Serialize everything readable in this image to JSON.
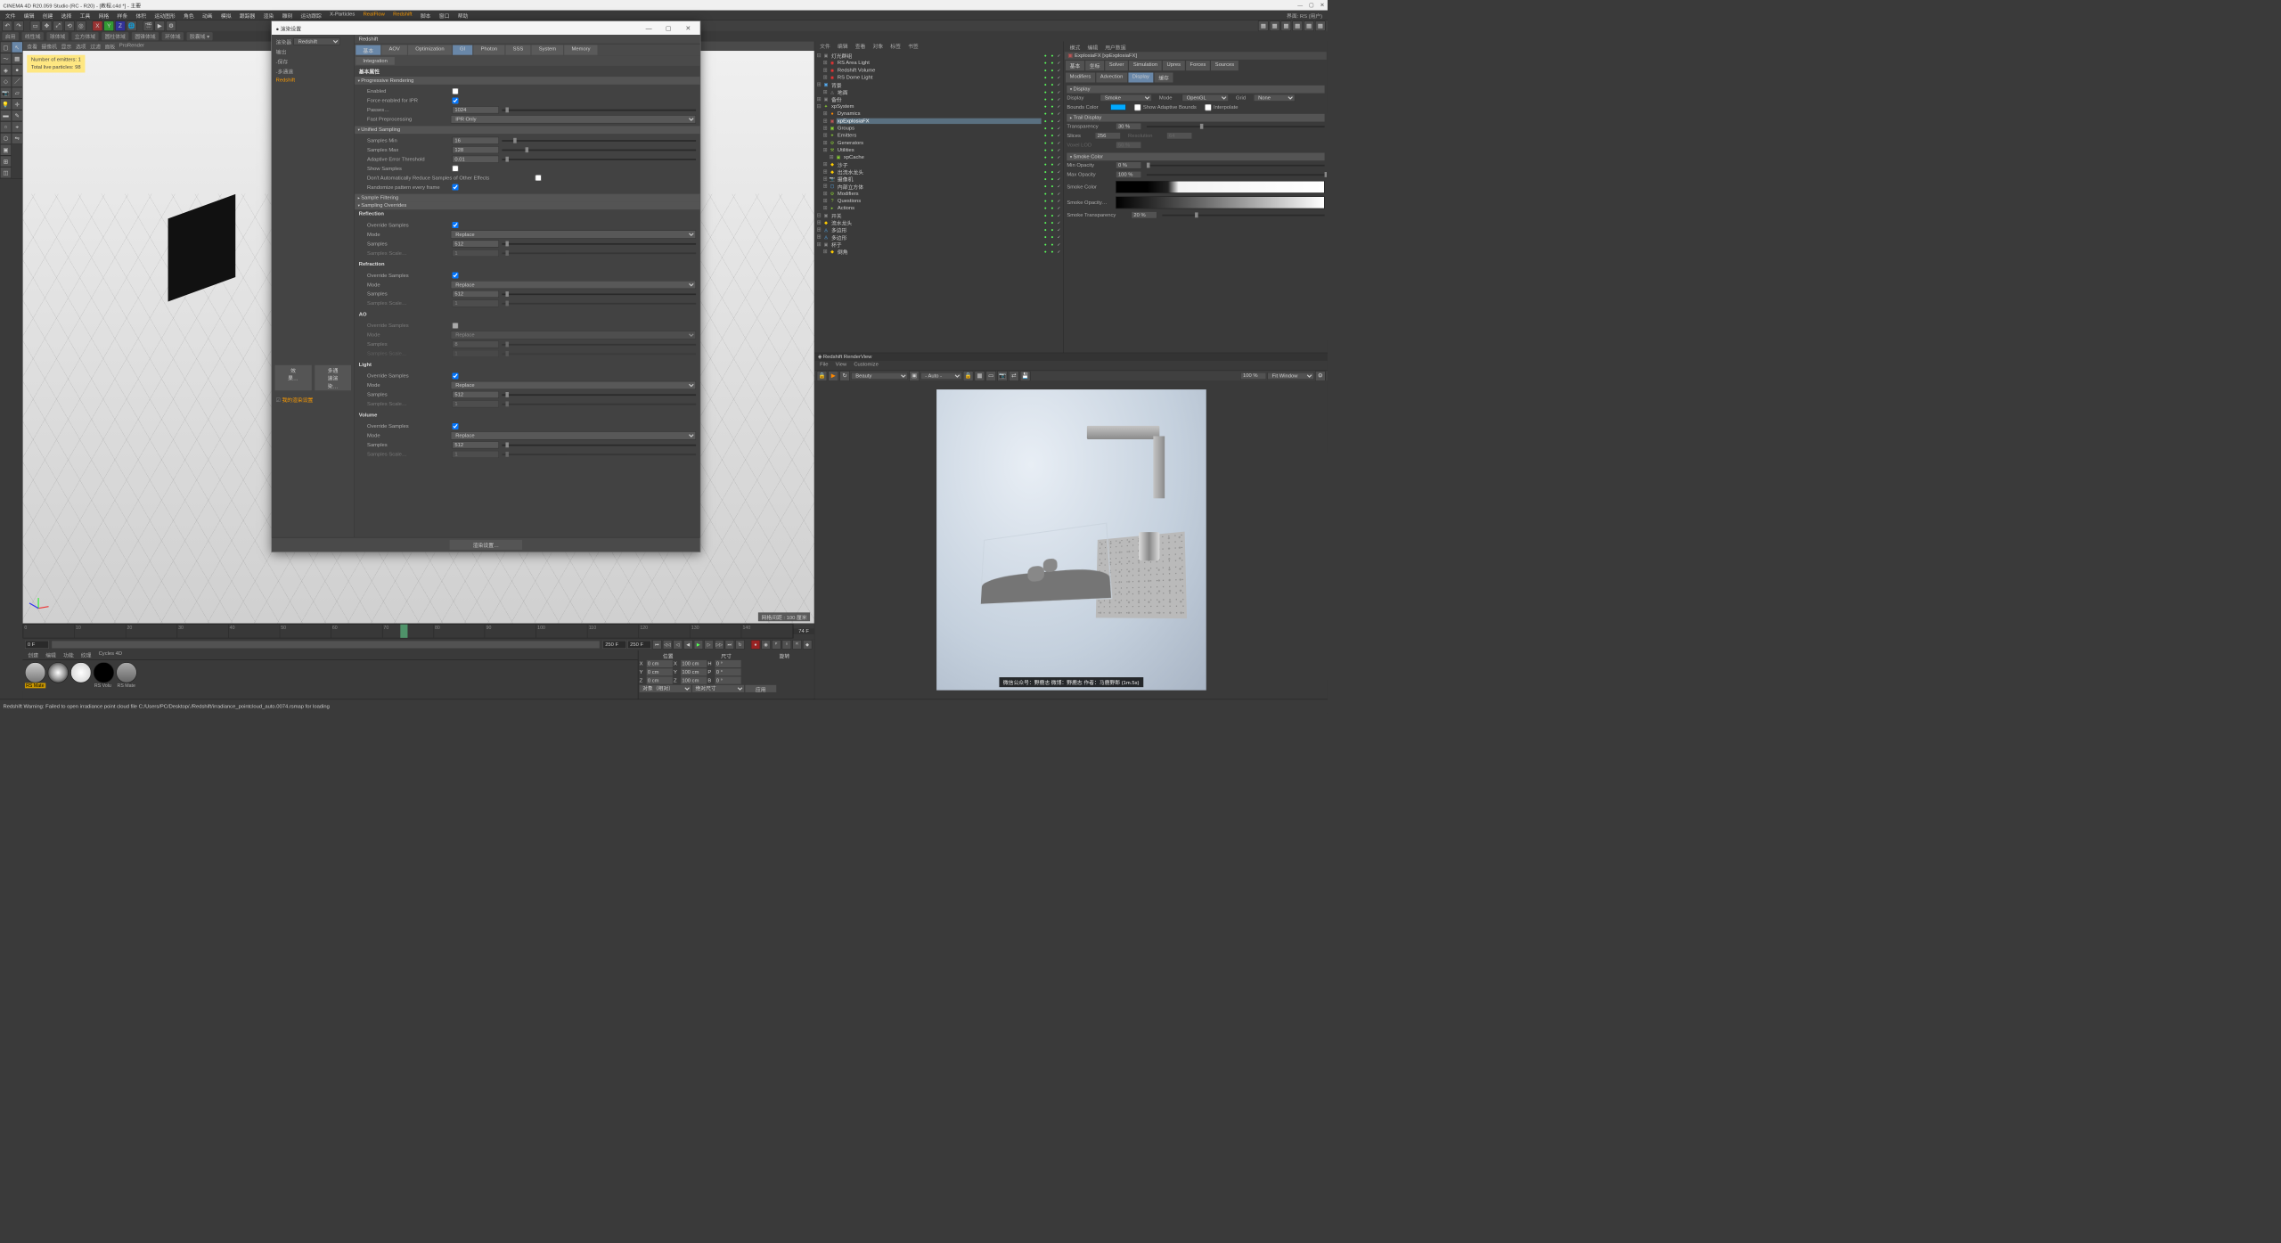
{
  "window": {
    "title": "CINEMA 4D R20.059 Studio (RC - R20) - [教程.c4d *] - 主要",
    "topright": "界面:  RS (用户)"
  },
  "menubar": [
    "文件",
    "编辑",
    "创建",
    "选择",
    "工具",
    "网格",
    "样条",
    "体积",
    "运动图形",
    "角色",
    "动画",
    "模拟",
    "跟踪器",
    "渲染",
    "雕刻",
    "运动跟踪",
    "X-Particles",
    "RealFlow",
    "Redshift",
    "脚本",
    "窗口",
    "帮助"
  ],
  "mode_tabs": [
    "启用",
    "线性域",
    "球体域",
    "立方体域",
    "圆柱体域",
    "圆锥体域",
    "环体域",
    "胶囊域 ▾"
  ],
  "view_menu": [
    "查看",
    "摄像机",
    "显示",
    "选项",
    "过滤",
    "面板",
    "ProRender"
  ],
  "hud": {
    "l1": "Number of emitters: 1",
    "l2": "Total live particles: 98"
  },
  "grid_info": "网格间距 : 100 厘米",
  "render_dialog": {
    "title": "渲染设置",
    "renderer_label": "渲染器",
    "renderer": "Redshift",
    "sidebar": [
      "输出",
      "-保存",
      "-多通道",
      "Redshift"
    ],
    "sidebar_footer": [
      "效果…",
      "多通道渲染…",
      "我的渲染设置"
    ],
    "footer_btn": "渲染设置…",
    "main_header": "Redshift",
    "tabs": [
      "基本",
      "AOV",
      "Optimization",
      "GI",
      "Photon",
      "SSS",
      "System",
      "Memory"
    ],
    "integration_tab": "Integration",
    "section_title": "基本属性",
    "groups": {
      "progressive": {
        "title": "Progressive Rendering",
        "enabled": "Enabled",
        "force_ipr": "Force enabled for IPR",
        "passes": "Passes…",
        "passes_val": "1024",
        "fastpre": "Fast Preprocessing",
        "fastpre_val": "IPR Only"
      },
      "unified": {
        "title": "Unified Sampling",
        "min": "Samples Min",
        "min_val": "16",
        "max": "Samples Max",
        "max_val": "128",
        "thresh": "Adaptive Error Threshold",
        "thresh_val": "0.01",
        "show": "Show Samples",
        "auto": "Don't Automatically Reduce Samples of Other Effects",
        "rand": "Randomize pattern every frame"
      },
      "filtering": {
        "title": "Sample Filtering"
      },
      "overrides": {
        "title": "Sampling Overrides"
      },
      "block": {
        "override": "Override Samples",
        "mode": "Mode",
        "mode_val": "Replace",
        "samples": "Samples",
        "samples_val": "512",
        "scale": "Samples Scale…",
        "scale_val": "1"
      },
      "sub": {
        "reflection": "Reflection",
        "refraction": "Refraction",
        "ao": "AO",
        "light": "Light",
        "volume": "Volume"
      }
    }
  },
  "timeline": {
    "start": "0 F",
    "end": "250 F",
    "cur": "74 F",
    "ticks": [
      "0",
      "10",
      "20",
      "30",
      "40",
      "50",
      "60",
      "70",
      "80",
      "90",
      "100",
      "110",
      "120",
      "130",
      "140"
    ]
  },
  "materials": {
    "menu": [
      "创建",
      "编辑",
      "功能",
      "纹理",
      "Cycles 4D"
    ],
    "chips": [
      "RS Mate",
      "",
      "",
      "RS Volu",
      "RS Mate"
    ]
  },
  "coord": {
    "headers": [
      "位置",
      "尺寸",
      "旋转"
    ],
    "rows": [
      {
        "a": "X",
        "p": "0 cm",
        "s": "100 cm",
        "r": "0 °",
        "rl": "H"
      },
      {
        "a": "Y",
        "p": "0 cm",
        "s": "100 cm",
        "r": "0 °",
        "rl": "P"
      },
      {
        "a": "Z",
        "p": "0 cm",
        "s": "100 cm",
        "r": "0 °",
        "rl": "B"
      }
    ],
    "obj_mode": "对象（相对）",
    "size_mode": "绝对尺寸",
    "apply": "应用"
  },
  "objects": {
    "menu": [
      "文件",
      "编辑",
      "查看",
      "对象",
      "标签",
      "书签"
    ],
    "tree": [
      {
        "d": 0,
        "ic": "▣",
        "c": "#888",
        "n": "灯光群组",
        "open": true
      },
      {
        "d": 1,
        "ic": "◉",
        "c": "#e33",
        "n": "RS Area Light"
      },
      {
        "d": 1,
        "ic": "◉",
        "c": "#e33",
        "n": "Redshift Volume"
      },
      {
        "d": 1,
        "ic": "◉",
        "c": "#e33",
        "n": "RS Dome Light"
      },
      {
        "d": 0,
        "ic": "▣",
        "c": "#5ae",
        "n": "背景"
      },
      {
        "d": 1,
        "ic": "◬",
        "c": "#888",
        "n": "地面"
      },
      {
        "d": 0,
        "ic": "▣",
        "c": "#888",
        "n": "备份"
      },
      {
        "d": 0,
        "ic": "✦",
        "c": "#8c3",
        "n": "xpSystem",
        "open": true
      },
      {
        "d": 1,
        "ic": "●",
        "c": "#f80",
        "n": "Dynamics"
      },
      {
        "d": 1,
        "ic": "▣",
        "c": "#b55",
        "n": "xpExplosiaFX",
        "active": true
      },
      {
        "d": 1,
        "ic": "▣",
        "c": "#8c3",
        "n": "Groups"
      },
      {
        "d": 1,
        "ic": "✦",
        "c": "#8c3",
        "n": "Emitters"
      },
      {
        "d": 1,
        "ic": "⚙",
        "c": "#8c3",
        "n": "Generators"
      },
      {
        "d": 1,
        "ic": "⚒",
        "c": "#8c3",
        "n": "Utilities"
      },
      {
        "d": 2,
        "ic": "▣",
        "c": "#8c3",
        "n": "xpCache"
      },
      {
        "d": 1,
        "ic": "◆",
        "c": "#fc0",
        "n": "沙子"
      },
      {
        "d": 1,
        "ic": "◆",
        "c": "#fc0",
        "n": "出流水龙头"
      },
      {
        "d": 1,
        "ic": "📷",
        "c": "#5ae",
        "n": "摄像机"
      },
      {
        "d": 1,
        "ic": "▢",
        "c": "#5ae",
        "n": "内部立方体"
      },
      {
        "d": 1,
        "ic": "⚙",
        "c": "#8c3",
        "n": "Modifiers"
      },
      {
        "d": 1,
        "ic": "?",
        "c": "#8c3",
        "n": "Questions"
      },
      {
        "d": 1,
        "ic": "▸",
        "c": "#8c3",
        "n": "Actions"
      },
      {
        "d": 0,
        "ic": "▣",
        "c": "#888",
        "n": "开关",
        "open": true
      },
      {
        "d": 0,
        "ic": "◆",
        "c": "#fc0",
        "n": "流水龙头"
      },
      {
        "d": 0,
        "ic": "◬",
        "c": "#5ae",
        "n": "多边形"
      },
      {
        "d": 0,
        "ic": "◬",
        "c": "#5ae",
        "n": "多边形"
      },
      {
        "d": 0,
        "ic": "▣",
        "c": "#888",
        "n": "杯子"
      },
      {
        "d": 1,
        "ic": "◆",
        "c": "#fc0",
        "n": "倒角"
      }
    ]
  },
  "attributes": {
    "menu": [
      "模式",
      "编辑",
      "用户数据"
    ],
    "title_icon": "▣",
    "title": "ExplosiaFX [xpExplosiaFX]",
    "tabs1": [
      "基本",
      "坐标",
      "Solver",
      "Simulation",
      "Upres",
      "Forces",
      "Sources"
    ],
    "tabs2": [
      "Modifiers",
      "Advection",
      "Display",
      "缓存"
    ],
    "active_tab": "Display",
    "section": "Display",
    "display_label": "Display",
    "display_sel": "Smoke",
    "mode_label": "Mode",
    "mode_sel": "OpenGL",
    "grid_label": "Grid",
    "grid_sel": "None",
    "bounds_label": "Bounds Color",
    "bounds_color": "#00a9ff",
    "adaptive_label": "Show Adaptive Bounds",
    "interpolate_label": "Interpolate",
    "trail": "Trail Display",
    "transparency_label": "Transparency",
    "transparency_val": "30 %",
    "slices_label": "Slices",
    "slices_val": "256",
    "resolution_label": "Resolution",
    "resolution_val": "64",
    "voxel_label": "Voxel LOD",
    "voxel_val": "50 %",
    "smoke_color_section": "Smoke Color",
    "min_opacity_label": "Min Opacity",
    "min_opacity_val": "0 %",
    "max_opacity_label": "Max Opacity",
    "max_opacity_val": "100 %",
    "smoke_color_label": "Smoke Color",
    "smoke_opacity_label": "Smoke Opacity…",
    "smoke_transparency_label": "Smoke Transparency",
    "smoke_transparency_val": "20 %"
  },
  "renderview": {
    "title": "Redshift RenderView",
    "menu": [
      "File",
      "View",
      "Customize"
    ],
    "toolbar": {
      "channel": "Beauty",
      "auto": "- Auto -",
      "zoom": "100 %",
      "fit": "Fit Window"
    },
    "caption": "微信公众号：野鹿志   微博：野鹿志   作者：马鹿野郎   (1m.5s)"
  },
  "status": {
    "warn": "Redshift Warning: Failed to open irradiance point cloud file C:/Users/PC/Desktop/./Redshift/irradiance_pointcloud_auto.0074.rsmap for loading"
  }
}
